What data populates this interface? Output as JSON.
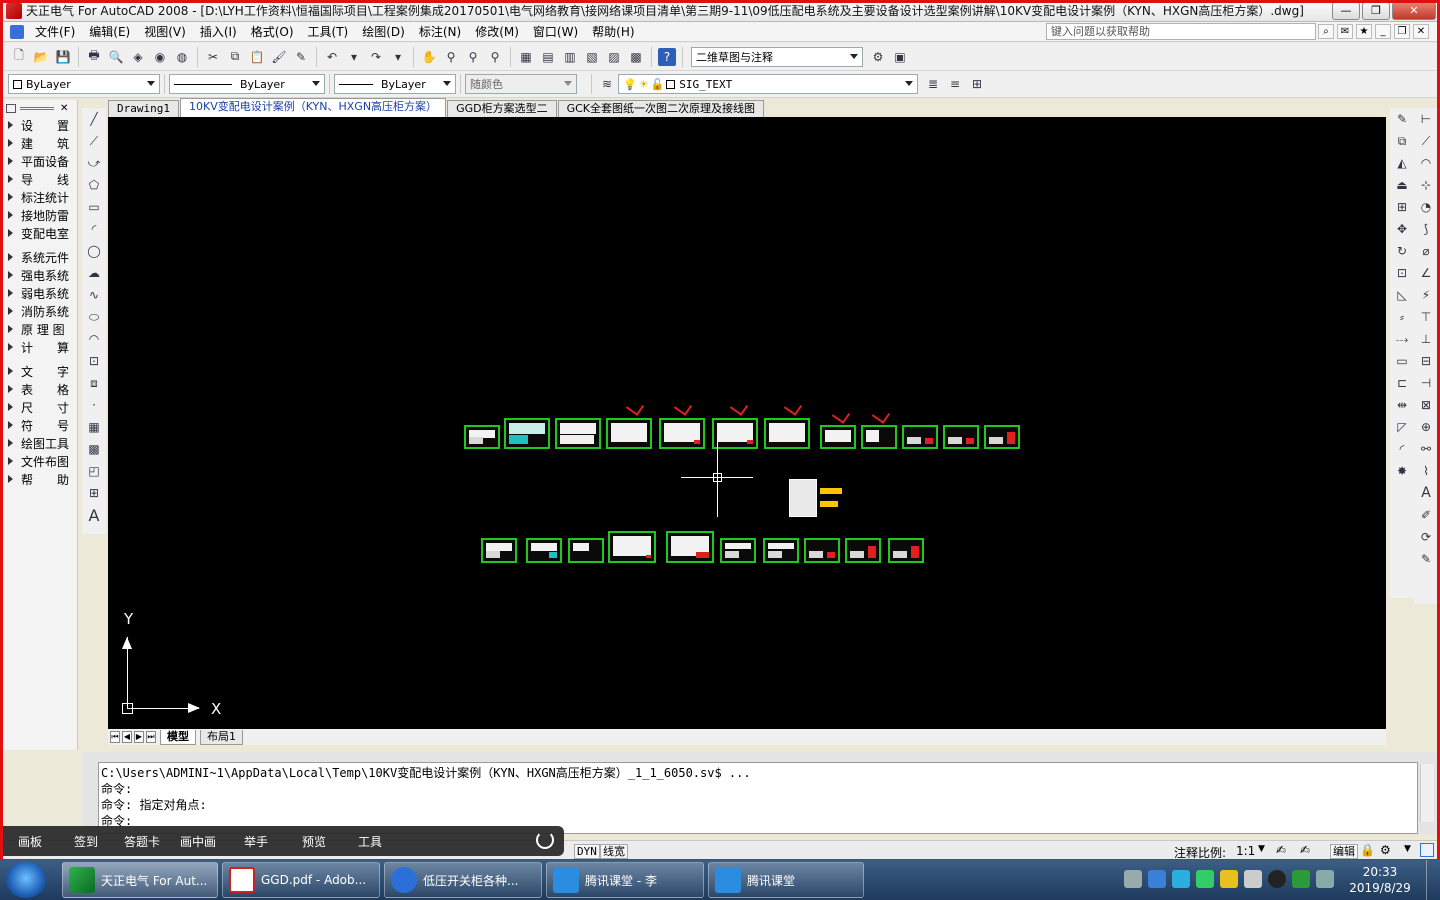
{
  "window": {
    "title": "天正电气 For AutoCAD 2008 - [D:\\LYH工作资料\\恒福国际项目\\工程案例集成20170501\\电气网络教育\\接网络课项目清单\\第三期9-11\\09低压配电系统及主要设备设计选型案例讲解\\10KV变配电设计案例（KYN、HXGN高压柜方案）.dwg]",
    "minimize": "—",
    "restore": "❐",
    "close": "✕"
  },
  "menu": {
    "items": [
      "文件(F)",
      "编辑(E)",
      "视图(V)",
      "插入(I)",
      "格式(O)",
      "工具(T)",
      "绘图(D)",
      "标注(N)",
      "修改(M)",
      "窗口(W)",
      "帮助(H)"
    ],
    "help_placeholder": "键入问题以获取帮助"
  },
  "toolbar": {
    "workspace": "二维草图与注释",
    "layer_color": "ByLayer",
    "linetype": "ByLayer",
    "lineweight": "ByLayer",
    "plot_style": "随颜色",
    "layer_name": "SIG_TEXT"
  },
  "left_panel": {
    "items": [
      "设　　置",
      "建　　筑",
      "平面设备",
      "导　　线",
      "标注统计",
      "接地防雷",
      "变配电室",
      "系统元件",
      "强电系统",
      "弱电系统",
      "消防系统",
      "原 理 图",
      "计　　算",
      "文　　字",
      "表　　格",
      "尺　　寸",
      "符　　号",
      "绘图工具",
      "文件布图",
      "帮　　助"
    ]
  },
  "doc_tabs": [
    "Drawing1",
    "10KV变配电设计案例（KYN、HXGN高压柜方案）",
    "GGD柜方案选型二",
    "GCK全套图纸一次图二次原理及接线图"
  ],
  "ucs": {
    "x": "X",
    "y": "Y"
  },
  "layout_tabs": [
    "模型",
    "布局1"
  ],
  "command": {
    "lines": [
      "C:\\Users\\ADMINI~1\\AppData\\Local\\Temp\\10KV变配电设计案例（KYN、HXGN高压柜方案）_1_1_6050.sv$ ...",
      "命令:",
      "命令: 指定对角点:",
      "命令:"
    ]
  },
  "status": {
    "dyn": "DYN",
    "lw": "线宽",
    "scale_label": "注释比例:",
    "scale_value": "1:1",
    "edit": "编辑"
  },
  "overlay": {
    "items": [
      "画板",
      "签到",
      "答题卡",
      "画中画",
      "举手",
      "预览",
      "工具"
    ]
  },
  "taskbar": {
    "items": [
      "天正电气 For Aut...",
      "GGD.pdf - Adob...",
      "低压开关柜各种...",
      "腾讯课堂 - 李",
      "腾讯课堂"
    ],
    "time": "20:33",
    "date": "2019/8/29"
  }
}
